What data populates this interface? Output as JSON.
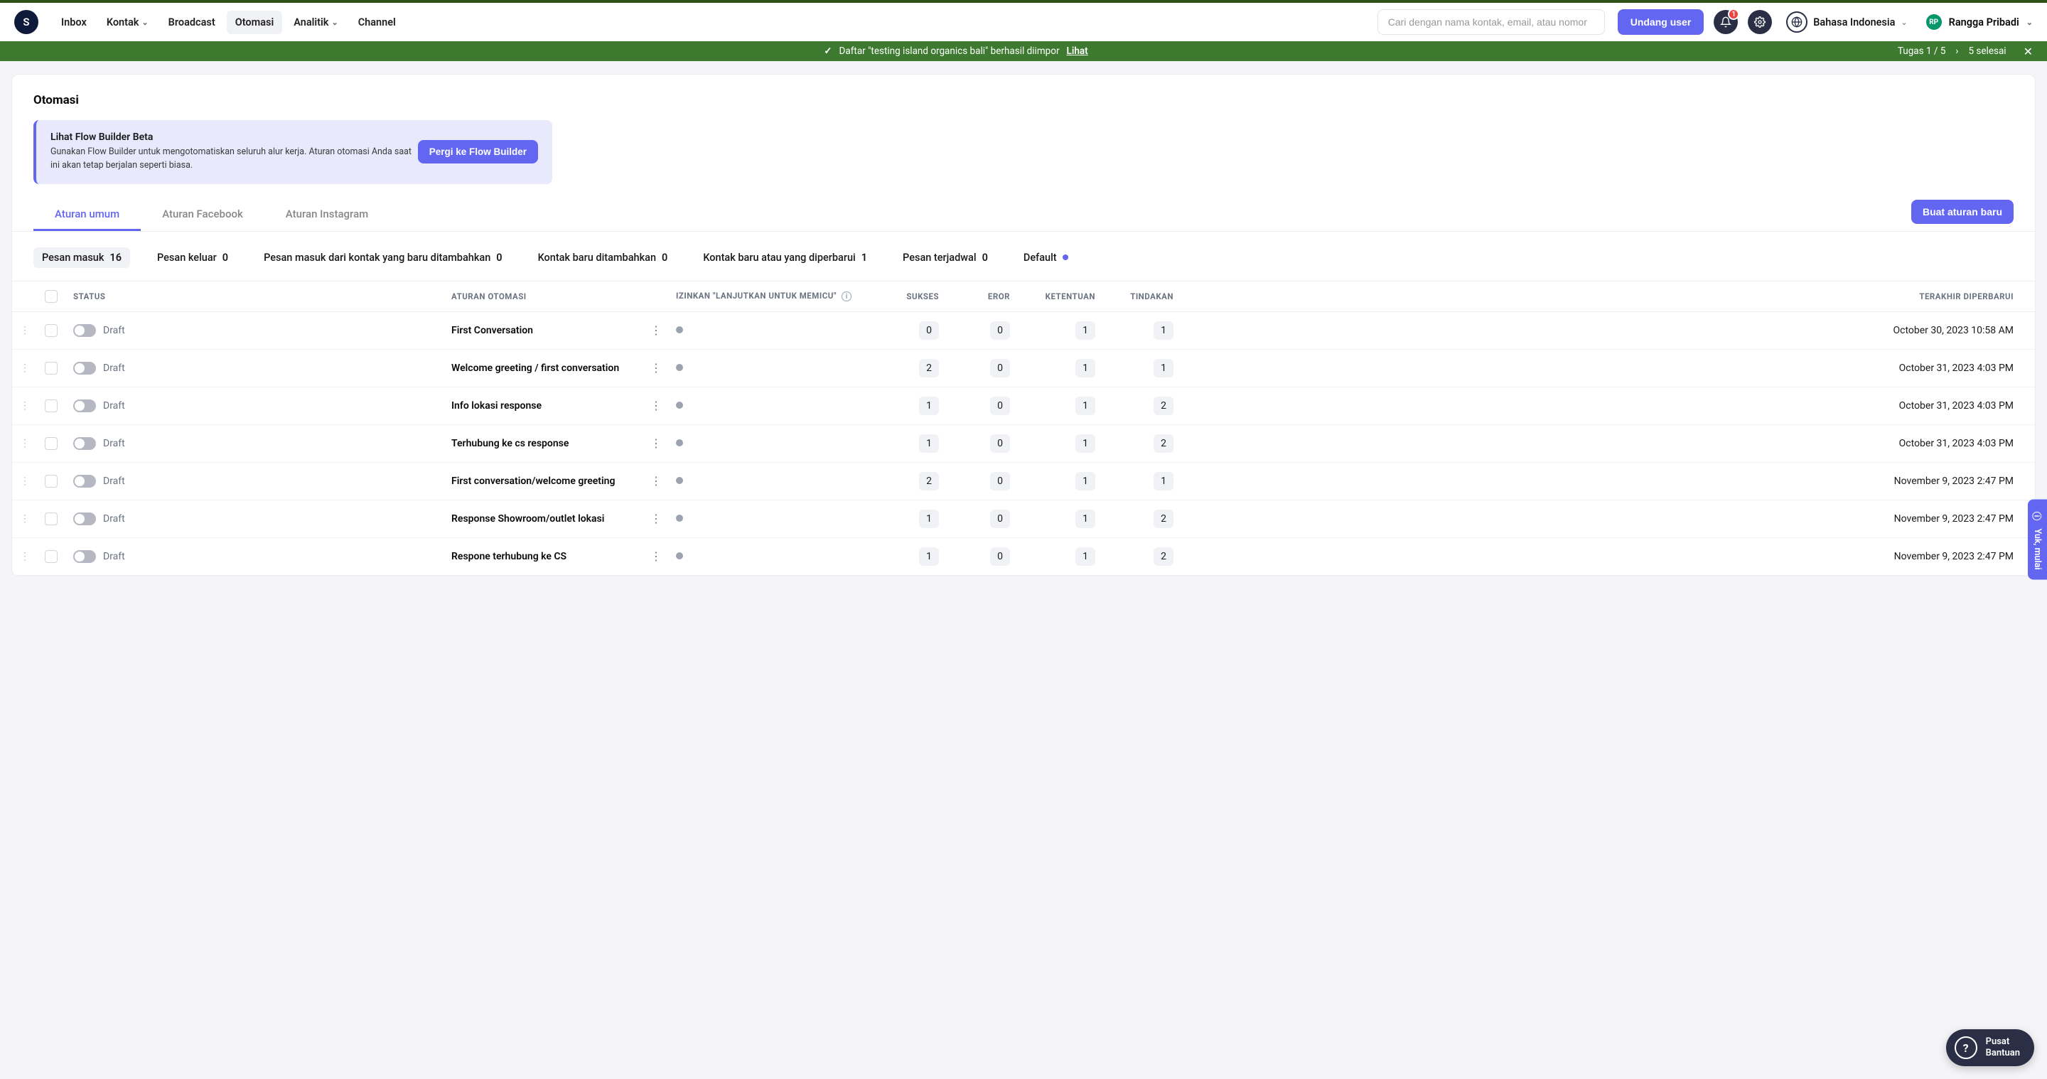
{
  "topbar": {
    "logo_letter": "S",
    "nav": {
      "inbox": "Inbox",
      "kontak": "Kontak",
      "broadcast": "Broadcast",
      "otomasi": "Otomasi",
      "analitik": "Analitik",
      "channel": "Channel"
    },
    "search_placeholder": "Cari dengan nama kontak, email, atau nomor",
    "invite_label": "Undang user",
    "notif_count": "1",
    "language_label": "Bahasa Indonesia",
    "user_initials": "RP",
    "user_name": "Rangga Pribadi"
  },
  "banner": {
    "message": "Daftar \"testing island organics bali\" berhasil diimpor",
    "link_label": "Lihat",
    "task_label": "Tugas 1 / 5",
    "done_label": "5 selesai"
  },
  "page": {
    "title": "Otomasi",
    "flowbuilder": {
      "title": "Lihat Flow Builder Beta",
      "desc": "Gunakan Flow Builder untuk mengotomatiskan seluruh alur kerja. Aturan otomasi Anda saat ini akan tetap berjalan seperti biasa.",
      "button": "Pergi ke Flow Builder"
    },
    "tabs": {
      "general": "Aturan umum",
      "facebook": "Aturan Facebook",
      "instagram": "Aturan Instagram"
    },
    "new_rule_button": "Buat aturan baru",
    "filters": [
      {
        "label": "Pesan masuk",
        "count": "16",
        "active": true
      },
      {
        "label": "Pesan keluar",
        "count": "0"
      },
      {
        "label": "Pesan masuk dari kontak yang baru ditambahkan",
        "count": "0"
      },
      {
        "label": "Kontak baru ditambahkan",
        "count": "0"
      },
      {
        "label": "Kontak baru atau yang diperbarui",
        "count": "1"
      },
      {
        "label": "Pesan terjadwal",
        "count": "0"
      },
      {
        "label": "Default",
        "count": "",
        "dot": true
      }
    ],
    "columns": {
      "status": "STATUS",
      "rule": "ATURAN OTOMASI",
      "allow": "IZINKAN \"LANJUTKAN UNTUK MEMICU\"",
      "success": "SUKSES",
      "error": "EROR",
      "condition": "KETENTUAN",
      "action": "TINDAKAN",
      "updated": "TERAKHIR DIPERBARUI"
    },
    "status_draft": "Draft",
    "rows": [
      {
        "name": "First Conversation",
        "success": "0",
        "error": "0",
        "condition": "1",
        "action": "1",
        "updated": "October 30, 2023 10:58 AM"
      },
      {
        "name": "Welcome greeting / first conversation",
        "success": "2",
        "error": "0",
        "condition": "1",
        "action": "1",
        "updated": "October 31, 2023 4:03 PM"
      },
      {
        "name": "Info lokasi response",
        "success": "1",
        "error": "0",
        "condition": "1",
        "action": "2",
        "updated": "October 31, 2023 4:03 PM"
      },
      {
        "name": "Terhubung ke cs response",
        "success": "1",
        "error": "0",
        "condition": "1",
        "action": "2",
        "updated": "October 31, 2023 4:03 PM"
      },
      {
        "name": "First conversation/welcome greeting",
        "success": "2",
        "error": "0",
        "condition": "1",
        "action": "1",
        "updated": "November 9, 2023 2:47 PM"
      },
      {
        "name": "Response Showroom/outlet lokasi",
        "success": "1",
        "error": "0",
        "condition": "1",
        "action": "2",
        "updated": "November 9, 2023 2:47 PM"
      },
      {
        "name": "Respone terhubung ke CS",
        "success": "1",
        "error": "0",
        "condition": "1",
        "action": "2",
        "updated": "November 9, 2023 2:47 PM"
      }
    ]
  },
  "side_tab": "Yuk, mulai",
  "help": {
    "line1": "Pusat",
    "line2": "Bantuan"
  }
}
